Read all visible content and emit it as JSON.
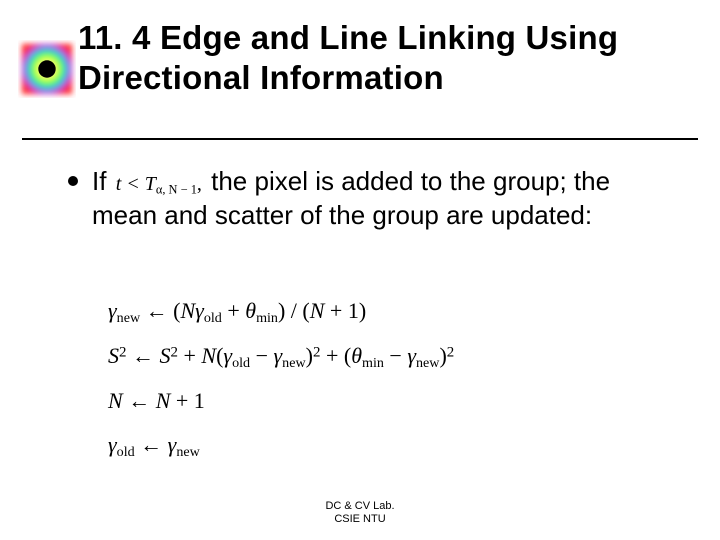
{
  "slide": {
    "title": "11. 4 Edge and Line Linking Using Directional Information",
    "bullet": {
      "before": "If",
      "condition": "t < T",
      "condition_sub": "α, N − 1",
      "condition_tail": ",",
      "after": "the pixel is added to the group; the mean and scatter of the group are updated:"
    },
    "equations": {
      "l1a": "γ",
      "l1a_sub": "new",
      "l1arrow": " ← (",
      "l1b": "N",
      "l1c": "γ",
      "l1c_sub": "old",
      "l1plus": " + ",
      "l1d": "θ",
      "l1d_sub": "min",
      "l1close": ") / (",
      "l1n": "N",
      "l1tail": " + 1)",
      "l2a": "S",
      "l2a_sup": "2",
      "l2arrow": " ← ",
      "l2b": "S",
      "l2b_sup": "2",
      "l2plus": " + ",
      "l2N": "N",
      "l2open": "(",
      "l2g1": "γ",
      "l2g1_sub": "old",
      "l2minus": " − ",
      "l2g2": "γ",
      "l2g2_sub": "new",
      "l2close": ")",
      "l2close_sup": "2",
      "l2plus2": " + (",
      "l2t": "θ",
      "l2t_sub": "min",
      "l2minus2": " − ",
      "l2g3": "γ",
      "l2g3_sub": "new",
      "l2close2": ")",
      "l2close2_sup": "2",
      "l3a": "N",
      "l3arrow": " ← ",
      "l3b": "N",
      "l3tail": " + 1",
      "l4a": "γ",
      "l4a_sub": "old",
      "l4arrow": " ← ",
      "l4b": "γ",
      "l4b_sub": "new"
    },
    "footer": {
      "line1": "DC & CV Lab.",
      "line2": "CSIE NTU"
    }
  }
}
